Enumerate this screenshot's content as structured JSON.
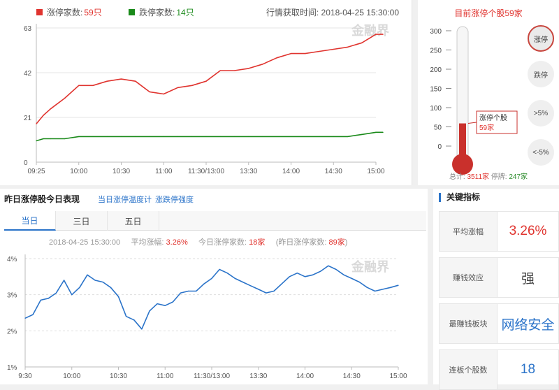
{
  "top_chart": {
    "legend_up_label": "涨停家数:",
    "legend_up_count": "59只",
    "legend_down_label": "跌停家数:",
    "legend_down_count": "14只",
    "fetch_time": "行情获取时间: 2018-04-25 15:30:00",
    "watermark": "金融界",
    "colors": {
      "up": "#e0342f",
      "down": "#1a8a1a"
    }
  },
  "thermometer": {
    "title": "目前涨停个股59家",
    "tick_labels": [
      "300",
      "250",
      "200",
      "150",
      "100",
      "50",
      "0"
    ],
    "level_value": 59,
    "callout_line1": "涨停个股",
    "callout_line2": "59家",
    "buttons": [
      "涨停",
      "跌停",
      ">5%",
      "<-5%"
    ],
    "footer_total_label": "总计:",
    "footer_total": "3511家",
    "footer_halt_label": "停牌:",
    "footer_halt": "247家"
  },
  "bottom_section": {
    "title": "昨日涨停股今日表现",
    "link1": "当日涨停温度计",
    "link2": "涨跌停强度",
    "tabs": [
      "当日",
      "三日",
      "五日"
    ],
    "stats": {
      "date": "2018-04-25 15:30:00",
      "avg_label": "平均涨幅:",
      "avg_value": "3.26%",
      "today_label": "今日涨停家数:",
      "today_value": "18家",
      "yesterday_label": "(昨日涨停家数:",
      "yesterday_value": "89家",
      "close_paren": ")"
    },
    "watermark": "金融界"
  },
  "key_indicators": {
    "title": "关键指标",
    "rows": [
      {
        "label": "平均涨幅",
        "value": "3.26%"
      },
      {
        "label": "赚钱效应",
        "value": "强"
      },
      {
        "label": "最赚钱板块",
        "value": "网络安全"
      },
      {
        "label": "连板个股数",
        "value": "18"
      }
    ]
  },
  "chart_data": [
    {
      "type": "line",
      "title": "",
      "xlabel": "",
      "ylabel": "",
      "x_ticks": [
        "09:25",
        "10:00",
        "10:30",
        "11:00",
        "11:30/13:00",
        "13:30",
        "14:00",
        "14:30",
        "15:00"
      ],
      "y_ticks": [
        "0",
        "21",
        "42",
        "63"
      ],
      "ylim": [
        0,
        63
      ],
      "grid": true,
      "x_session_minutes": [
        0,
        5,
        10,
        20,
        30,
        40,
        50,
        60,
        70,
        80,
        90,
        100,
        110,
        120,
        130,
        140,
        150,
        160,
        170,
        180,
        190,
        200,
        210,
        220,
        230,
        240,
        245
      ],
      "series": [
        {
          "name": "涨停家数",
          "color": "#e0342f",
          "values": [
            18,
            22,
            25,
            30,
            36,
            36,
            38,
            39,
            38,
            33,
            32,
            35,
            36,
            38,
            43,
            43,
            44,
            46,
            49,
            51,
            51,
            52,
            53,
            54,
            56,
            60,
            60
          ]
        },
        {
          "name": "跌停家数",
          "color": "#1a8a1a",
          "values": [
            10,
            11,
            11,
            11,
            12,
            12,
            12,
            12,
            12,
            12,
            12,
            12,
            12,
            12,
            12,
            12,
            12,
            12,
            12,
            12,
            12,
            12,
            12,
            12,
            13,
            14,
            14
          ]
        }
      ]
    },
    {
      "type": "line",
      "title": "",
      "xlabel": "",
      "ylabel": "",
      "x_ticks": [
        "9:30",
        "10:00",
        "10:30",
        "11:00",
        "11:30/13:00",
        "13:30",
        "14:00",
        "14:30",
        "15:00"
      ],
      "y_ticks": [
        "1%",
        "2%",
        "3%",
        "4%"
      ],
      "ylim": [
        1,
        4
      ],
      "grid": true,
      "x_session_minutes": [
        0,
        5,
        10,
        15,
        20,
        25,
        30,
        35,
        40,
        45,
        50,
        55,
        60,
        65,
        70,
        75,
        80,
        85,
        90,
        95,
        100,
        105,
        110,
        115,
        120,
        125,
        130,
        135,
        140,
        145,
        150,
        155,
        160,
        165,
        170,
        175,
        180,
        185,
        190,
        195,
        200,
        205,
        210,
        215,
        220,
        225,
        230,
        235,
        240
      ],
      "series": [
        {
          "name": "平均涨幅",
          "color": "#2a73c9",
          "values": [
            2.35,
            2.45,
            2.85,
            2.9,
            3.05,
            3.4,
            3.0,
            3.2,
            3.55,
            3.4,
            3.35,
            3.2,
            2.95,
            2.4,
            2.3,
            2.05,
            2.55,
            2.75,
            2.7,
            2.8,
            3.05,
            3.1,
            3.1,
            3.3,
            3.45,
            3.7,
            3.6,
            3.45,
            3.35,
            3.25,
            3.15,
            3.05,
            3.1,
            3.3,
            3.5,
            3.6,
            3.5,
            3.55,
            3.65,
            3.8,
            3.7,
            3.55,
            3.45,
            3.35,
            3.2,
            3.1,
            3.15,
            3.2,
            3.26
          ]
        }
      ]
    }
  ]
}
